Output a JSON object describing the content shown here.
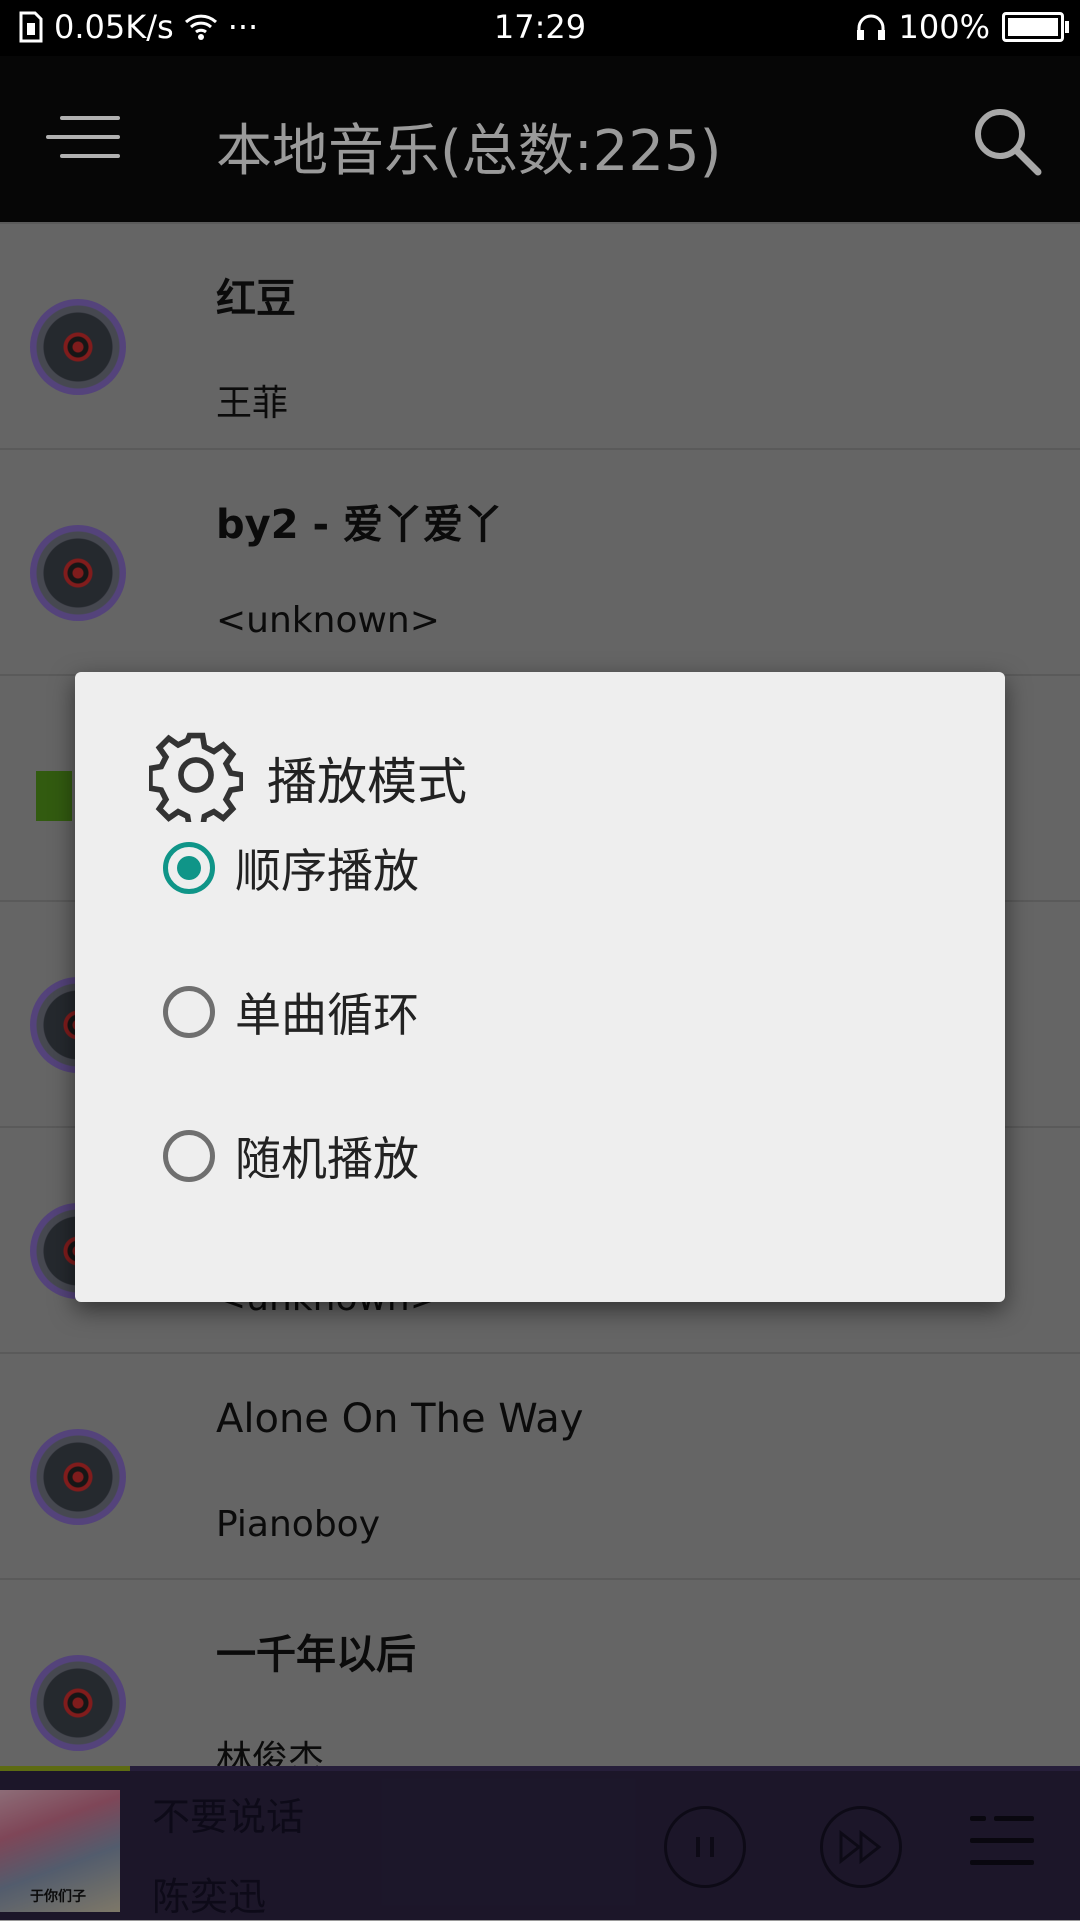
{
  "status_bar": {
    "speed": "0.05K/s",
    "more": "···",
    "time": "17:29",
    "battery": "100%",
    "battery_level": 1.0
  },
  "header": {
    "title": "本地音乐(总数:225)",
    "menu_icon": "hamburger-menu-icon",
    "search_icon": "search-icon"
  },
  "songs": [
    {
      "title": "红豆",
      "artist": "王菲"
    },
    {
      "title": "by2 - 爱丫爱丫",
      "artist": "<unknown>"
    },
    {
      "title": "",
      "artist": ""
    },
    {
      "title": "",
      "artist": ""
    },
    {
      "title": "",
      "artist": "<unknown>"
    },
    {
      "title": "Alone On The Way",
      "artist": "Pianoboy"
    },
    {
      "title": "一千年以后",
      "artist": "林俊杰"
    }
  ],
  "dialog": {
    "title": "播放模式",
    "icon": "gear-icon",
    "options": [
      {
        "label": "顺序播放",
        "selected": true
      },
      {
        "label": "单曲循环",
        "selected": false
      },
      {
        "label": "随机播放",
        "selected": false
      }
    ]
  },
  "player": {
    "title": "不要说话",
    "artist": "陈奕迅",
    "album_text": "于你们子",
    "progress": 0.12
  },
  "colors": {
    "accent": "#0f9588",
    "player_bg": "#2b2340",
    "progress": "#8fa51c"
  }
}
